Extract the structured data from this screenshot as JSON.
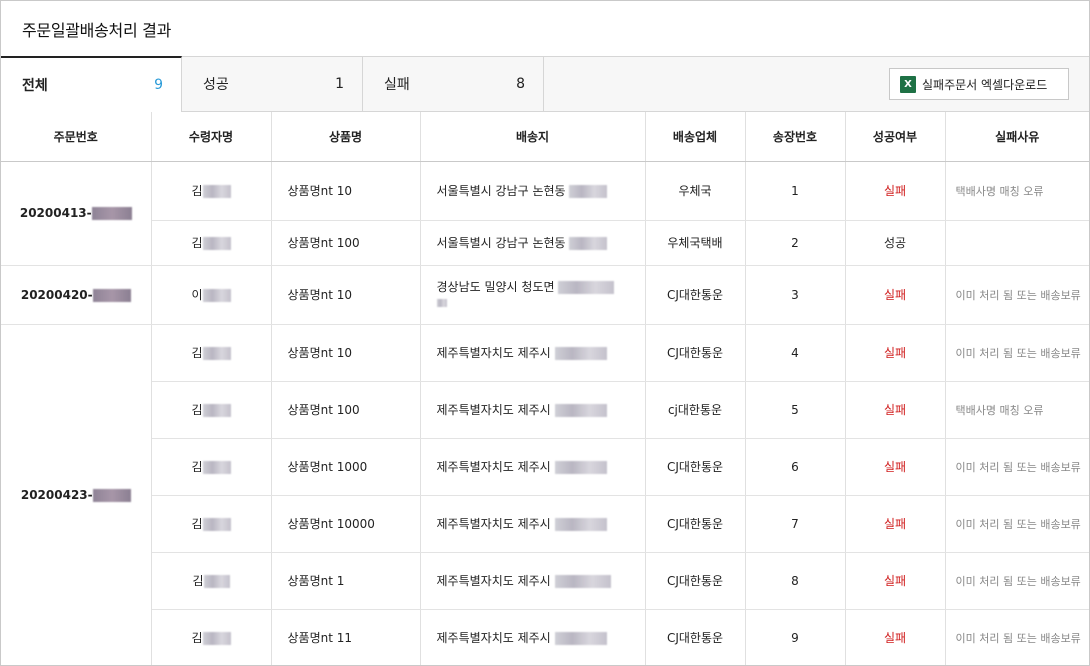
{
  "page": {
    "title": "주문일괄배송처리 결과"
  },
  "summary": {
    "total_label": "전체",
    "total_count": "9",
    "success_label": "성공",
    "success_count": "1",
    "fail_label": "실패",
    "fail_count": "8",
    "download_label": "실패주문서 엑셀다운로드",
    "download_icon": "excel-icon"
  },
  "colors": {
    "accent": "#2a9bd8",
    "fail": "#d01c1c",
    "excel": "#1e7145"
  },
  "table": {
    "headers": [
      "주문번호",
      "수령자명",
      "상품명",
      "배송지",
      "배송업체",
      "송장번호",
      "성공여부",
      "실패사유"
    ],
    "orders": [
      {
        "order_no": "20200413-",
        "rowspan": 2
      },
      {
        "order_no": "20200420-",
        "rowspan": 1
      },
      {
        "order_no": "20200423-",
        "rowspan": 6
      }
    ],
    "rows": [
      {
        "recipient": "김",
        "product": "상품명nt 10",
        "address": "서울특별시 강남구 논현동",
        "carrier": "우체국",
        "invoice": "1",
        "result": "실패",
        "reason": "택배사명 매칭 오류"
      },
      {
        "recipient": "김",
        "product": "상품명nt 100",
        "address": "서울특별시 강남구 논현동",
        "carrier": "우체국택배",
        "invoice": "2",
        "result": "성공",
        "reason": ""
      },
      {
        "recipient": "이",
        "product": "상품명nt 10",
        "address": "경상남도 밀양시 청도면",
        "carrier": "CJ대한통운",
        "invoice": "3",
        "result": "실패",
        "reason": "이미 처리 됨 또는 배송보류"
      },
      {
        "recipient": "김",
        "product": "상품명nt 10",
        "address": "제주특별자치도 제주시",
        "carrier": "CJ대한통운",
        "invoice": "4",
        "result": "실패",
        "reason": "이미 처리 됨 또는 배송보류"
      },
      {
        "recipient": "김",
        "product": "상품명nt 100",
        "address": "제주특별자치도 제주시",
        "carrier": "cj대한통운",
        "invoice": "5",
        "result": "실패",
        "reason": "택배사명 매칭 오류"
      },
      {
        "recipient": "김",
        "product": "상품명nt 1000",
        "address": "제주특별자치도 제주시",
        "carrier": "CJ대한통운",
        "invoice": "6",
        "result": "실패",
        "reason": "이미 처리 됨 또는 배송보류"
      },
      {
        "recipient": "김",
        "product": "상품명nt 10000",
        "address": "제주특별자치도 제주시",
        "carrier": "CJ대한통운",
        "invoice": "7",
        "result": "실패",
        "reason": "이미 처리 됨 또는 배송보류"
      },
      {
        "recipient": "김",
        "product": "상품명nt 1",
        "address": "제주특별자치도 제주시",
        "carrier": "CJ대한통운",
        "invoice": "8",
        "result": "실패",
        "reason": "이미 처리 됨 또는 배송보류"
      },
      {
        "recipient": "김",
        "product": "상품명nt 11",
        "address": "제주특별자치도 제주시",
        "carrier": "CJ대한통운",
        "invoice": "9",
        "result": "실패",
        "reason": "이미 처리 됨 또는 배송보류"
      }
    ]
  }
}
